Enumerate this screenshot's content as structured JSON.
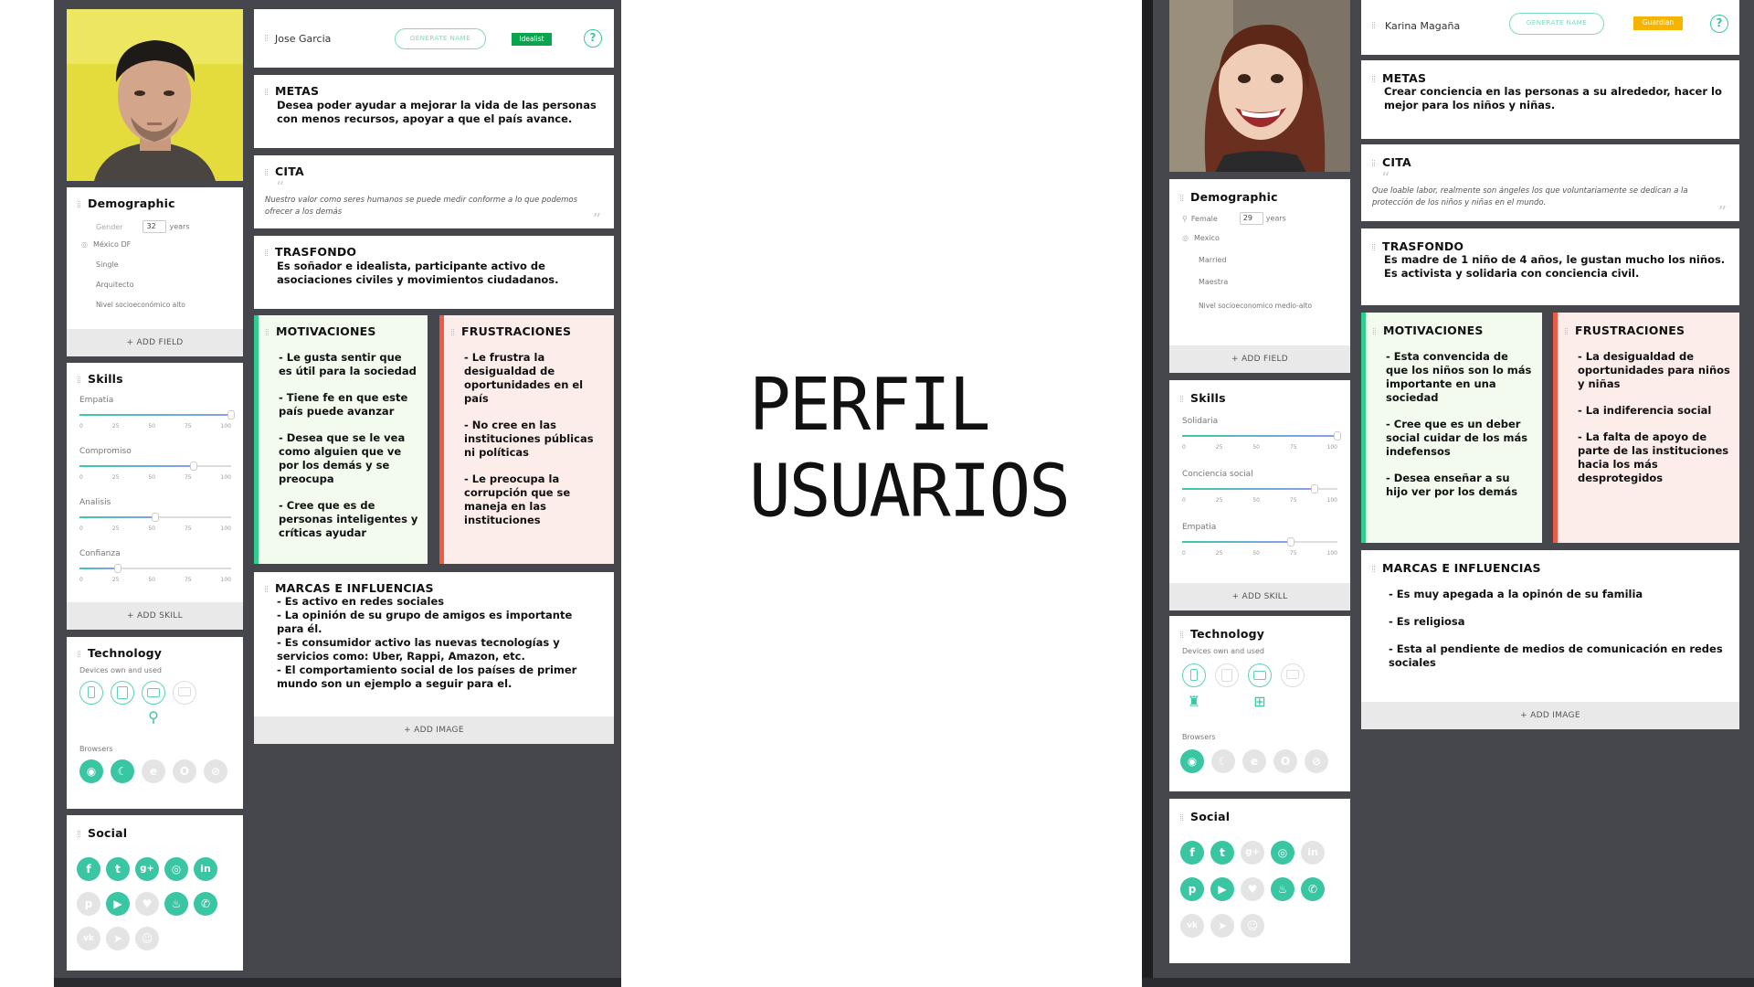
{
  "title": {
    "line1": "PERFIL",
    "line2": "USUARIOS"
  },
  "left": {
    "name": "Jose Garcia",
    "generate_label": "GENERATE NAME",
    "tag": "Idealist",
    "tag_color": "#0aa34e",
    "help": "?",
    "metas": {
      "title": "METAS",
      "body": "Desea poder ayudar a mejorar la vida de las personas con menos recursos, apoyar a que el país avance."
    },
    "cita": {
      "title": "CITA",
      "body": "Nuestro valor como seres humanos se puede medir conforme a lo que podemos ofrecer a los demás"
    },
    "trasfondo": {
      "title": "TRASFONDO",
      "body": " Es soñador e idealista, participante activo de asociaciones civiles y movimientos ciudadanos."
    },
    "motivaciones": {
      "title": "MOTIVACIONES",
      "items": [
        "- Le gusta sentir que es útil para la sociedad",
        "- Tiene fe en que este país puede avanzar",
        "- Desea que se le vea como alguien que ve por los demás y se preocupa",
        "- Cree que es de personas inteligentes y críticas ayudar"
      ]
    },
    "frustraciones": {
      "title": "FRUSTRACIONES",
      "items": [
        "- Le frustra la desigualdad de oportunidades en el país",
        "- No cree en las instituciones públicas ni políticas",
        "- Le preocupa la corrupción que se maneja en las instituciones"
      ]
    },
    "marcas": {
      "title": "MARCAS E INFLUENCIAS",
      "items": [
        "- Es activo en redes sociales",
        "- La opinión de su grupo de amigos es importante para él.",
        "-  Es consumidor activo las nuevas tecnologías y servicios como: Uber, Rappi, Amazon, etc.",
        "- El comportamiento social de los países de primer mundo son un ejemplo a seguir para el."
      ]
    },
    "add_image": "+ ADD IMAGE",
    "demographic": {
      "title": "Demographic",
      "gender": "Gender",
      "age": "32",
      "age_unit": "years",
      "location": "México DF",
      "status": "Single",
      "job": "Arquitecto",
      "level": "Nivel socioeconómico alto",
      "add": "+ ADD FIELD"
    },
    "skills": {
      "title": "Skills",
      "add": "+ ADD SKILL",
      "ticks": [
        "0",
        "25",
        "50",
        "75",
        "100"
      ],
      "items": [
        {
          "name": "Empatia",
          "value": 100
        },
        {
          "name": "Compromiso",
          "value": 75
        },
        {
          "name": "Analisis",
          "value": 50
        },
        {
          "name": "Confianza",
          "value": 25
        }
      ]
    },
    "technology": {
      "title": "Technology",
      "devices_label": "Devices own and used",
      "browsers_label": "Browsers"
    },
    "social": {
      "title": "Social"
    }
  },
  "right": {
    "name": "Karina Magaña",
    "generate_label": "GENERATE NAME",
    "tag": "Guardian",
    "tag_color": "#f5b400",
    "help": "?",
    "metas": {
      "title": "METAS",
      "body": "Crear conciencia en las personas a su alrededor, hacer lo mejor para los niños y niñas."
    },
    "cita": {
      "title": "CITA",
      "body": "Que loable labor, realmente son ángeles los que voluntariamente se dedican a la protección de los niños y niñas en el mundo."
    },
    "trasfondo": {
      "title": "TRASFONDO",
      "body": "Es madre de 1 niño de 4 años, le gustan mucho los niños. Es activista y solidaria con conciencia civil."
    },
    "motivaciones": {
      "title": "MOTIVACIONES",
      "items": [
        "- Esta convencida de que los niños son lo más importante en una sociedad",
        "- Cree que es un deber social cuidar de los más indefensos",
        "- Desea enseñar a su hijo ver por los demás"
      ]
    },
    "frustraciones": {
      "title": "FRUSTRACIONES",
      "items": [
        "- La desigualdad de oportunidades para niños y niñas",
        "- La indiferencia social",
        "- La falta de apoyo de parte de las instituciones hacia los más desprotegidos"
      ]
    },
    "marcas": {
      "title": "MARCAS E INFLUENCIAS",
      "items": [
        "- Es muy apegada a la opinón  de su familia",
        "- Es religiosa",
        "- Esta al pendiente de medios de comunicación en redes sociales"
      ]
    },
    "add_image": "+ ADD IMAGE",
    "demographic": {
      "title": "Demographic",
      "gender": "Female",
      "age": "29",
      "age_unit": "years",
      "location": "Mexico",
      "status": "Married",
      "job": "Maestra",
      "level": "Nivel socioeconomico medio-alto",
      "add": "+ ADD FIELD"
    },
    "skills": {
      "title": "Skills",
      "add": "+ ADD SKILL",
      "ticks": [
        "0",
        "25",
        "50",
        "75",
        "100"
      ],
      "items": [
        {
          "name": "Solidaria",
          "value": 100
        },
        {
          "name": "Conciencia social",
          "value": 85
        },
        {
          "name": "Empatia",
          "value": 70
        }
      ]
    },
    "technology": {
      "title": "Technology",
      "devices_label": "Devices own and used",
      "browsers_label": "Browsers"
    },
    "social": {
      "title": "Social"
    }
  }
}
